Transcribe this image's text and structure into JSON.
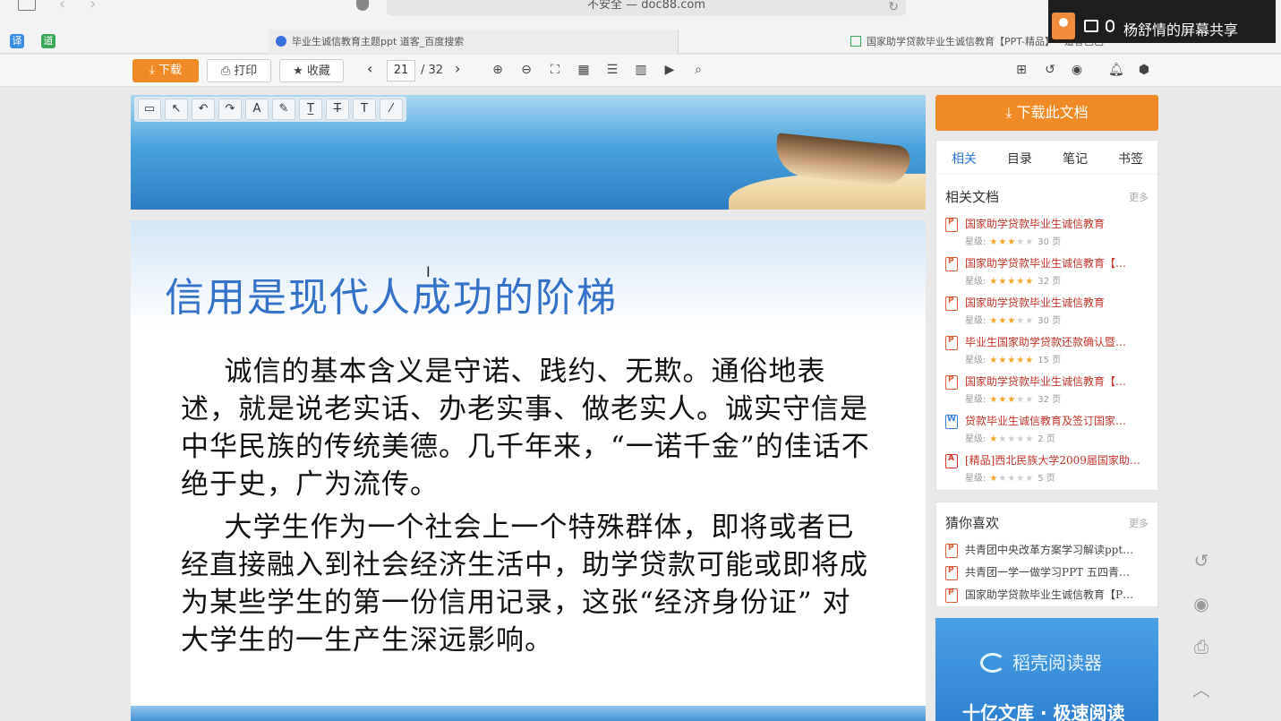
{
  "browser": {
    "address": "不安全 — doc88.com",
    "tabs": [
      {
        "label": "毕业生诚信教育主题ppt 道客_百度搜索"
      },
      {
        "label": "国家助学贷款毕业生诚信教育【PPT-精品】 - 道客巴巴"
      }
    ],
    "ext_icons": [
      "译",
      "道"
    ]
  },
  "screen_share": {
    "label": "杨舒情的屏幕共享"
  },
  "toolbar": {
    "download_label": "下载",
    "print_label": "打印",
    "favorite_label": "收藏",
    "current_page": "21",
    "total_pages": "/ 32"
  },
  "slide": {
    "title": "信用是现代人成功的阶梯",
    "paragraph1": "诚信的基本含义是守诺、践约、无欺。通俗地表述，就是说老实话、办老实事、做老实人。诚实守信是中华民族的传统美德。几千年来，“一诺千金”的佳话不绝于史，广为流传。",
    "paragraph2": "大学生作为一个社会上一个特殊群体，即将或者已经直接融入到社会经济生活中，助学贷款可能或即将成为某些学生的第一份信用记录，这张“经济身份证” 对大学生的一生产生深远影响。"
  },
  "sidebar": {
    "download_doc_label": "下载此文档",
    "tabs": [
      "相关",
      "目录",
      "笔记",
      "书签"
    ],
    "related_title": "相关文档",
    "more_label": "更多",
    "rating_label": "星级:",
    "related_docs": [
      {
        "title": "国家助学贷款毕业生诚信教育",
        "stars": 3,
        "pages": "30 页",
        "type": "ppt"
      },
      {
        "title": "国家助学贷款毕业生诚信教育【…",
        "stars": 5,
        "pages": "32 页",
        "type": "ppt"
      },
      {
        "title": "国家助学贷款毕业生诚信教育",
        "stars": 3,
        "pages": "30 页",
        "type": "ppt"
      },
      {
        "title": "毕业生国家助学贷款还款确认暨…",
        "stars": 5,
        "pages": "15 页",
        "type": "ppt"
      },
      {
        "title": "国家助学贷款毕业生诚信教育【…",
        "stars": 3,
        "pages": "32 页",
        "type": "ppt"
      },
      {
        "title": "贷款毕业生诚信教育及签订国家…",
        "stars": 1,
        "pages": "2 页",
        "type": "word"
      },
      {
        "title": "[精品]西北民族大学2009届国家助…",
        "stars": 1,
        "pages": "5 页",
        "type": "pdf"
      }
    ],
    "guess_title": "猜你喜欢",
    "guess_docs": [
      {
        "title": "共青团中央改革方案学习解读ppt…"
      },
      {
        "title": "共青团一学一做学习PPT 五四青…"
      },
      {
        "title": "国家助学贷款毕业生诚信教育【P…"
      }
    ],
    "ad": {
      "logo": "稻壳阅读器",
      "slogan": "十亿文库 · 极速阅读"
    }
  }
}
